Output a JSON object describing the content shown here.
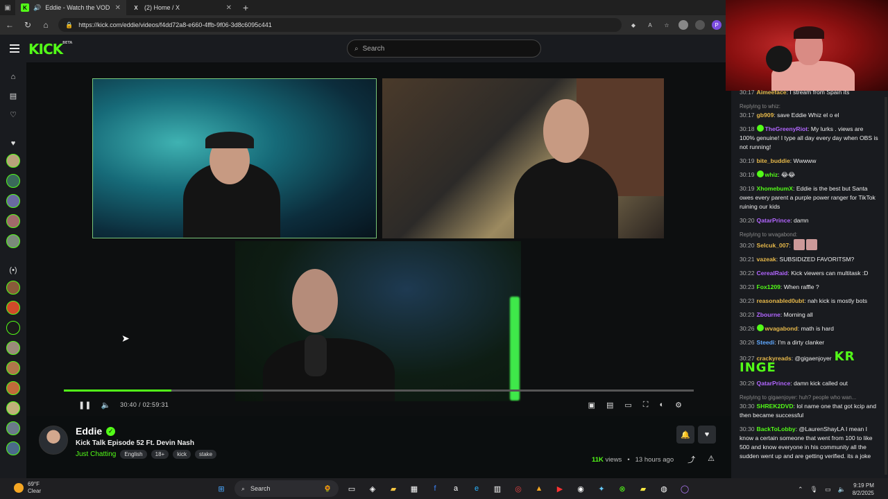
{
  "browser": {
    "tabs": [
      {
        "title": "Eddie - Watch the VOD on K",
        "favicon": "K",
        "active": true
      },
      {
        "title": "(2) Home / X",
        "favicon": "X",
        "active": false
      }
    ],
    "new_tab": "+",
    "url": "https://kick.com/eddie/videos/f4dd72a8-e660-4ffb-9f06-3d8c6095c441",
    "profile_badge": "P"
  },
  "kick": {
    "logo": "KICK",
    "logo_badge": "BETA",
    "search_placeholder": "Search"
  },
  "player": {
    "current_time": "30:40",
    "separator": "/",
    "duration": "02:59:31",
    "progress_fraction": 0.171
  },
  "channel": {
    "name": "Eddie",
    "title": "Kick Talk Episode 52 Ft. Devin Nash",
    "category": "Just Chatting",
    "tags": [
      "English",
      "18+",
      "kick",
      "stake"
    ],
    "views": "11K",
    "views_label": "views",
    "dot": "•",
    "age": "13 hours ago"
  },
  "chat": {
    "messages": [
      {
        "time": "30:17",
        "user": "Aimeeface",
        "color": "#e6b84a",
        "text": "I stream from Spain its"
      },
      {
        "reply": "Replying to whiz:",
        "time": "30:17",
        "user": "gb909",
        "color": "#e6b84a",
        "text": "save Eddie Whiz el o el"
      },
      {
        "time": "30:18",
        "user": "TheGreenyRiot",
        "color": "#b266ff",
        "badge": true,
        "text": "My lurks . views are 100% genuine! I type all day every day when OBS is not running!"
      },
      {
        "time": "30:19",
        "user": "bite_buddie",
        "color": "#e6b84a",
        "text": "Wwwww"
      },
      {
        "time": "30:19",
        "user": "whiz",
        "color": "#53fc18",
        "badge": true,
        "text": "😂😂"
      },
      {
        "time": "30:19",
        "user": "XhomebumX",
        "color": "#53fc18",
        "text": "Eddie is the best but Santa owes every parent a purple power ranger for TikTok ruining our kids"
      },
      {
        "time": "30:20",
        "user": "QatarPrince",
        "color": "#b266ff",
        "text": "damn"
      },
      {
        "reply": "Replying to wvagabond:",
        "time": "30:20",
        "user": "Selcuk_007",
        "color": "#e6b84a",
        "text": ""
      },
      {
        "time": "30:21",
        "user": "vazeak",
        "color": "#e6b84a",
        "text": "SUBSIDIZED FAVORITSM?"
      },
      {
        "time": "30:22",
        "user": "CerealRaid",
        "color": "#b266ff",
        "text": "Kick viewers can multitask :D"
      },
      {
        "time": "30:23",
        "user": "Fox1209",
        "color": "#53fc18",
        "text": "When raffle ?"
      },
      {
        "time": "30:23",
        "user": "reasonabled0ubt",
        "color": "#e6b84a",
        "text": "nah kick is mostly bots"
      },
      {
        "time": "30:23",
        "user": "Zbourne",
        "color": "#b266ff",
        "text": "Morning all"
      },
      {
        "time": "30:26",
        "user": "wvagabond",
        "color": "#e6b84a",
        "badge": true,
        "text": "math is hard"
      },
      {
        "time": "30:26",
        "user": "Steedi",
        "color": "#5fa8ff",
        "text": "I'm a dirty clanker"
      },
      {
        "time": "30:27",
        "user": "crackyreads",
        "color": "#e6b84a",
        "text": "@gigaenjoyer",
        "big": "KR INGE"
      },
      {
        "time": "30:29",
        "user": "QatarPrince",
        "color": "#b266ff",
        "text": "damn kick called out"
      },
      {
        "reply": "Replying to gigaenjoyer: huh? people who wan...",
        "time": "30:30",
        "user": "SHREK2DVD",
        "color": "#53fc18",
        "text": "lol name one that got kcip and then became successful"
      },
      {
        "time": "30:30",
        "user": "BackToLobby",
        "color": "#53fc18",
        "text": "@LaurenShayLA I mean I know a certain someone that went from 100 to like 500 and know everyone in his community all the sudden went up and are getting verified. its a joke"
      }
    ]
  },
  "taskbar": {
    "temp": "69°F",
    "weather": "Clear",
    "search": "Search",
    "time": "9:19 PM",
    "date": "8/2/2025"
  }
}
